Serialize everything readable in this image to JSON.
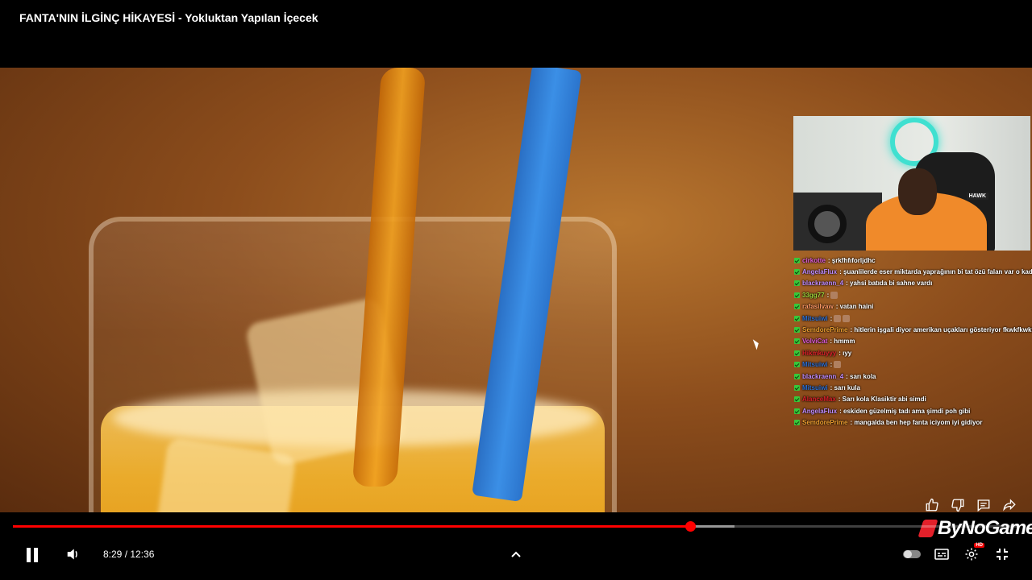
{
  "video": {
    "title": "FANTA'NIN İLGİNÇ HİKAYESİ - Yokluktan Yapılan İçecek"
  },
  "webcam": {
    "brand": "HAWK"
  },
  "chat": {
    "messages": [
      {
        "user": "cirkotte",
        "text": ": şrkfhfıforljdhc",
        "color": "#e05bd8"
      },
      {
        "user": "AngelaFlux",
        "text": ": şuanlilerde eser miktarda yaprağının bi tat özü falan var o kadar",
        "color": "#c08cff"
      },
      {
        "user": "blackraenn_4",
        "text": ": yahsi batıda bi sahne vardı",
        "color": "#c08cff"
      },
      {
        "user": "33gg77",
        "text": ":",
        "color": "#9bd43a"
      },
      {
        "user": "rafasilvaw",
        "text": ": vatan haini",
        "color": "#ff9966"
      },
      {
        "user": "Mitsuiwi",
        "text": ":",
        "color": "#2b6fd6"
      },
      {
        "user": "SemdorePrime",
        "text": ": hitlerin işgali diyor amerikan uçakları gösteriyor fkwkfkwkf",
        "color": "#f0a030"
      },
      {
        "user": "VolviCat",
        "text": ": hmmm",
        "color": "#e05bd8"
      },
      {
        "user": "Hikmkuyyy",
        "text": ": ıyy",
        "color": "#e0202a"
      },
      {
        "user": "Mitsuiwi",
        "text": ":",
        "color": "#2b6fd6"
      },
      {
        "user": "blackraenn_4",
        "text": ": sarı kola",
        "color": "#c08cff"
      },
      {
        "user": "Mitsuiwi",
        "text": ": sarı kula",
        "color": "#2b6fd6"
      },
      {
        "user": "AlanceMax",
        "text": ": Sarı kola Klasiktir abi simdi",
        "color": "#e0202a"
      },
      {
        "user": "AngelaFlux",
        "text": ": eskiden güzelmiş tadı ama şimdi poh gibi",
        "color": "#c08cff"
      },
      {
        "user": "SemdorePrime",
        "text": ": mangalda ben hep fanta iciyom iyi gidiyor",
        "color": "#f0a030"
      }
    ]
  },
  "overlay": {
    "sponsor": "ByNoGame"
  },
  "player": {
    "time_current": "8:29",
    "time_total": "12:36",
    "time_display": "8:29 / 12:36",
    "played_fraction": 0.673,
    "buffered_fraction": 0.717,
    "hd_label": "HD",
    "accent_color": "#ff0000"
  },
  "icons": {
    "actions": [
      "thumbs-up-icon",
      "thumbs-down-icon",
      "comment-icon",
      "share-icon"
    ],
    "controls": [
      "pause-icon",
      "volume-icon",
      "chevron-up-icon",
      "autoplay-toggle-icon",
      "subtitles-icon",
      "settings-icon",
      "exit-fullscreen-icon"
    ]
  }
}
